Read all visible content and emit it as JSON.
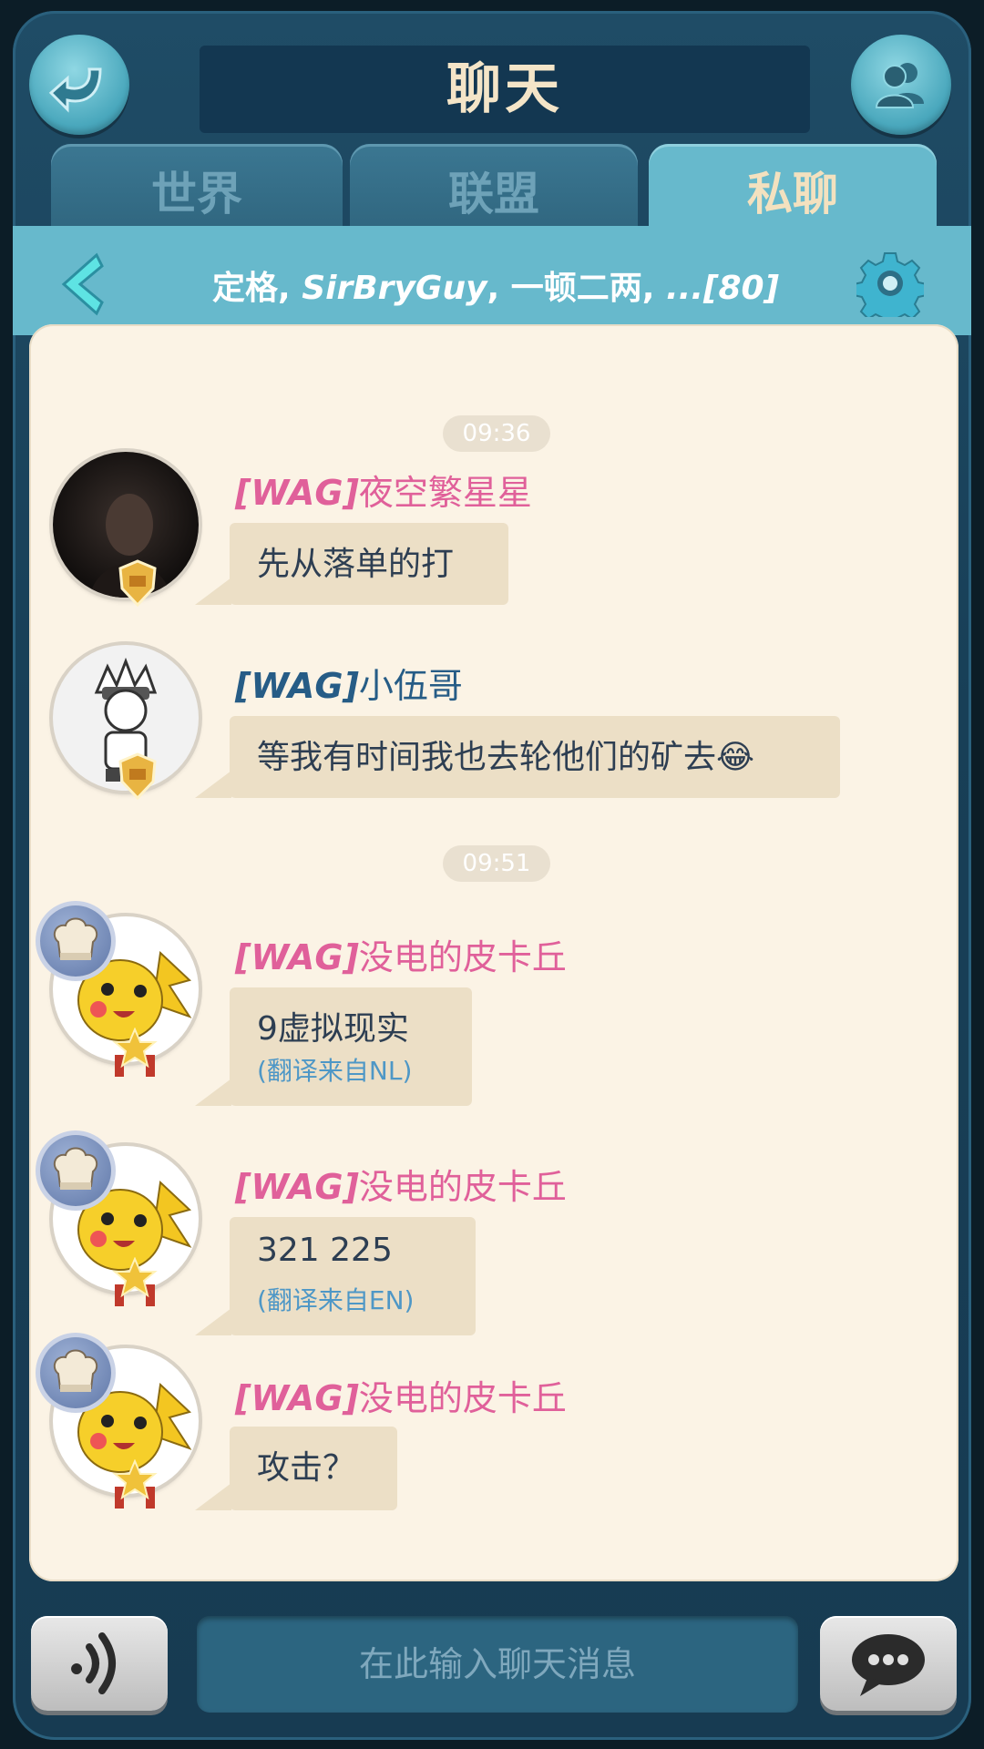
{
  "header": {
    "title": "聊天",
    "back_icon": "curved-back-arrow-icon",
    "friends_icon": "friends-icon"
  },
  "tabs": [
    {
      "label": "世界",
      "active": false
    },
    {
      "label": "联盟",
      "active": false
    },
    {
      "label": "私聊",
      "active": true
    }
  ],
  "conversation": {
    "title_part1": "定格, ",
    "title_part2": "SirBryGuy",
    "title_part3": ", 一顿二两, ",
    "title_part4": "...[80]"
  },
  "timestamps": [
    "09:36",
    "09:51"
  ],
  "messages": [
    {
      "tag": "[WAG]",
      "sender": "夜空繁星星",
      "text": "先从落单的打",
      "translation": "",
      "name_color": "#e0609a"
    },
    {
      "tag": "[WAG]",
      "sender": "小伍哥",
      "text": "等我有时间我也去轮他们的矿去😂",
      "translation": "",
      "name_color": "#265c86"
    },
    {
      "tag": "[WAG]",
      "sender": "没电的皮卡丘",
      "text": "9虚拟现实",
      "translation": "(翻译来自NL)",
      "name_color": "#e0609a"
    },
    {
      "tag": "[WAG]",
      "sender": "没电的皮卡丘",
      "text": "321 225",
      "translation": "(翻译来自EN)",
      "name_color": "#e0609a"
    },
    {
      "tag": "[WAG]",
      "sender": "没电的皮卡丘",
      "text": "攻击？",
      "translation": "",
      "name_color": "#e0609a"
    }
  ],
  "composer": {
    "placeholder": "在此输入聊天消息",
    "voice_icon": "voice-icon",
    "send_icon": "chat-bubble-icon"
  },
  "colors": {
    "accent": "#67b9cc",
    "background": "#1f4c66",
    "panel": "#fbf3e5",
    "bubble": "#ecdfc6"
  }
}
